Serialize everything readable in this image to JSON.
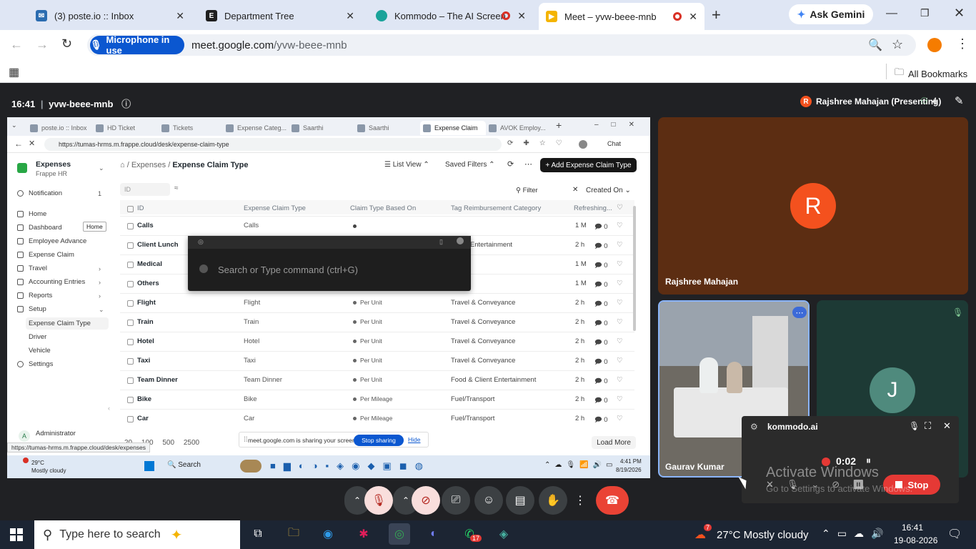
{
  "browser": {
    "tabs": [
      {
        "title": "(3) poste.io :: Inbox",
        "color": "#2b6cb0"
      },
      {
        "title": "Department Tree",
        "color": "#1f1f1f",
        "letter": "E"
      },
      {
        "title": "Kommodo – The AI Screen",
        "color": "#1aa39a"
      },
      {
        "title": "Meet – yvw-beee-mnb",
        "color": "#f4b400"
      }
    ],
    "new_tab": "+",
    "gemini": "Ask Gemini",
    "mic_chip": "Microphone in use",
    "url_host": "meet.google.com",
    "url_path": "/yvw-beee-mnb",
    "bookmarks": "All Bookmarks"
  },
  "meet": {
    "time": "16:41",
    "code": "yvw-beee-mnb",
    "presenter": "Rajshree Mahajan (Presenting)",
    "presenter_initial": "R",
    "people_count": "4",
    "participants": [
      {
        "name": "Rajshree Mahajan",
        "initial": "R",
        "color": "#f4511e"
      },
      {
        "name": "Gaurav Kumar"
      },
      {
        "initial": "J"
      }
    ],
    "watermark_line1": "Activate Windows",
    "watermark_line2": "Go to Settings to activate Windows."
  },
  "kommodo": {
    "title": "kommodo.ai",
    "timer": "0:02",
    "stop": "Stop"
  },
  "shared": {
    "tabs": [
      "poste.io :: Inbox",
      "HD Ticket",
      "Tickets",
      "Expense Categ...",
      "Saarthi",
      "Saarthi",
      "Expense Claim",
      "AVOK Employ..."
    ],
    "url": "https://tumas-hrms.m.frappe.cloud/desk/expense-claim-type",
    "chat": "Chat",
    "app_name": "Expenses",
    "app_sub": "Frappe HR",
    "sidebar": [
      {
        "label": "Notification",
        "badge": "1"
      },
      {
        "label": "Home"
      },
      {
        "label": "Dashboard"
      },
      {
        "label": "Employee Advance"
      },
      {
        "label": "Expense Claim"
      },
      {
        "label": "Travel"
      },
      {
        "label": "Accounting Entries"
      },
      {
        "label": "Reports"
      },
      {
        "label": "Setup"
      },
      {
        "label": "Expense Claim Type"
      },
      {
        "label": "Driver"
      },
      {
        "label": "Vehicle"
      },
      {
        "label": "Settings"
      }
    ],
    "tooltip": "Home",
    "user": "Administrator",
    "user_initial": "A",
    "status_url": "https://tumas-hrms.m.frappe.cloud/desk/expenses",
    "breadcrumb_parent": "Expenses",
    "breadcrumb_sep": "/",
    "page_title": "Expense Claim Type",
    "list_view": "List View",
    "saved_filters": "Saved Filters",
    "add_button": "+ Add Expense Claim Type",
    "id_placeholder": "ID",
    "filter": "Filter",
    "sort": "Created On",
    "columns": [
      "ID",
      "Expense Claim Type",
      "Claim Type Based On",
      "Tag Reimbursement Category",
      "Refreshing..."
    ],
    "rows": [
      {
        "id": "Calls",
        "type": "Calls",
        "based": "",
        "cat": "",
        "time": "1 M",
        "c": "0"
      },
      {
        "id": "Client Lunch",
        "type": "",
        "based": "",
        "cat": "Client Entertainment",
        "time": "2 h",
        "c": "0"
      },
      {
        "id": "Medical",
        "type": "",
        "based": "",
        "cat": "",
        "time": "1 M",
        "c": "0"
      },
      {
        "id": "Others",
        "type": "",
        "based": "",
        "cat": "",
        "time": "1 M",
        "c": "0"
      },
      {
        "id": "Flight",
        "type": "Flight",
        "based": "Per Unit",
        "cat": "Travel & Conveyance",
        "time": "2 h",
        "c": "0"
      },
      {
        "id": "Train",
        "type": "Train",
        "based": "Per Unit",
        "cat": "Travel & Conveyance",
        "time": "2 h",
        "c": "0"
      },
      {
        "id": "Hotel",
        "type": "Hotel",
        "based": "Per Unit",
        "cat": "Travel & Conveyance",
        "time": "2 h",
        "c": "0"
      },
      {
        "id": "Taxi",
        "type": "Taxi",
        "based": "Per Unit",
        "cat": "Travel & Conveyance",
        "time": "2 h",
        "c": "0"
      },
      {
        "id": "Team Dinner",
        "type": "Team Dinner",
        "based": "Per Unit",
        "cat": "Food & Client Entertainment",
        "time": "2 h",
        "c": "0"
      },
      {
        "id": "Bike",
        "type": "Bike",
        "based": "Per Mileage",
        "cat": "Fuel/Transport",
        "time": "2 h",
        "c": "0"
      },
      {
        "id": "Car",
        "type": "Car",
        "based": "Per Mileage",
        "cat": "Fuel/Transport",
        "time": "2 h",
        "c": "0"
      }
    ],
    "page_sizes": [
      "20",
      "100",
      "500",
      "2500"
    ],
    "load_more": "Load More",
    "command_placeholder": "Search or Type command (ctrl+G)",
    "sharing_text": "meet.google.com is sharing your screen.",
    "stop_sharing": "Stop sharing",
    "hide": "Hide",
    "weather_temp": "29°C",
    "weather_desc": "Mostly cloudy",
    "search": "Search",
    "clock_time": "4:41 PM",
    "clock_date": "8/19/2026"
  },
  "taskbar": {
    "search_placeholder": "Type here to search",
    "weather": "27°C  Mostly cloudy",
    "time": "16:41",
    "date": "19-08-2026",
    "weather_badge": "7",
    "whatsapp_badge": "17"
  }
}
